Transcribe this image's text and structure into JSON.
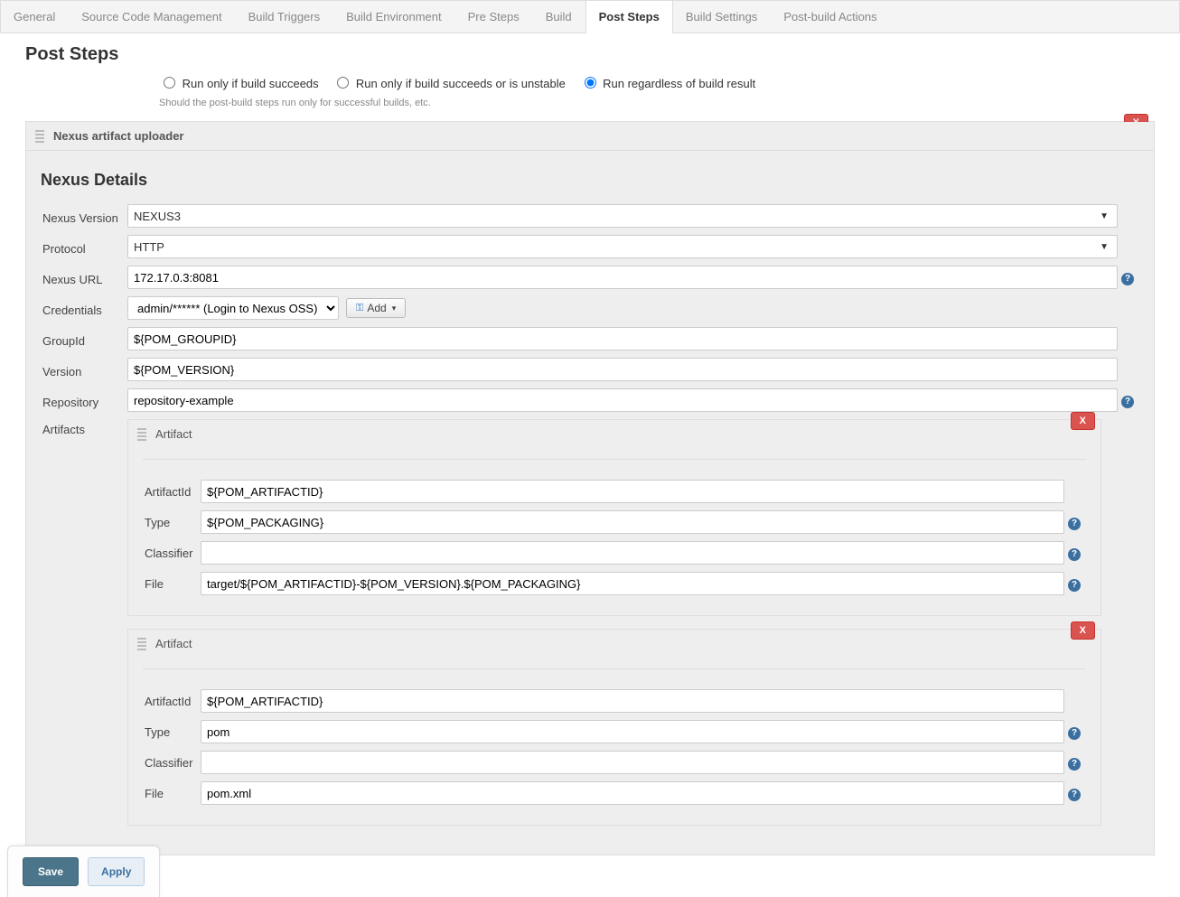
{
  "tabs": {
    "general": "General",
    "scm": "Source Code Management",
    "triggers": "Build Triggers",
    "env": "Build Environment",
    "pre": "Pre Steps",
    "build": "Build",
    "post": "Post Steps",
    "settings": "Build Settings",
    "postbuild": "Post-build Actions"
  },
  "section_title": "Post Steps",
  "run_condition": {
    "opt_success": "Run only if build succeeds",
    "opt_success_unstable": "Run only if build succeeds or is unstable",
    "opt_always": "Run regardless of build result",
    "selected": "always",
    "help": "Should the post-build steps run only for successful builds, etc."
  },
  "uploader": {
    "panel_title": "Nexus artifact uploader",
    "close": "X",
    "details_title": "Nexus Details",
    "fields": {
      "nexus_version_label": "Nexus Version",
      "nexus_version_value": "NEXUS3",
      "protocol_label": "Protocol",
      "protocol_value": "HTTP",
      "nexus_url_label": "Nexus URL",
      "nexus_url_value": "172.17.0.3:8081",
      "credentials_label": "Credentials",
      "credentials_value": "admin/****** (Login to Nexus OSS)",
      "add_label": "Add",
      "groupid_label": "GroupId",
      "groupid_value": "${POM_GROUPID}",
      "version_label": "Version",
      "version_value": "${POM_VERSION}",
      "repository_label": "Repository",
      "repository_value": "repository-example",
      "artifacts_label": "Artifacts"
    },
    "artifacts": [
      {
        "panel_label": "Artifact",
        "close": "X",
        "artifactid_label": "ArtifactId",
        "artifactid_value": "${POM_ARTIFACTID}",
        "type_label": "Type",
        "type_value": "${POM_PACKAGING}",
        "classifier_label": "Classifier",
        "classifier_value": "",
        "file_label": "File",
        "file_value": "target/${POM_ARTIFACTID}-${POM_VERSION}.${POM_PACKAGING}"
      },
      {
        "panel_label": "Artifact",
        "close": "X",
        "artifactid_label": "ArtifactId",
        "artifactid_value": "${POM_ARTIFACTID}",
        "type_label": "Type",
        "type_value": "pom",
        "classifier_label": "Classifier",
        "classifier_value": "",
        "file_label": "File",
        "file_value": "pom.xml"
      }
    ]
  },
  "buttons": {
    "save": "Save",
    "apply": "Apply"
  }
}
